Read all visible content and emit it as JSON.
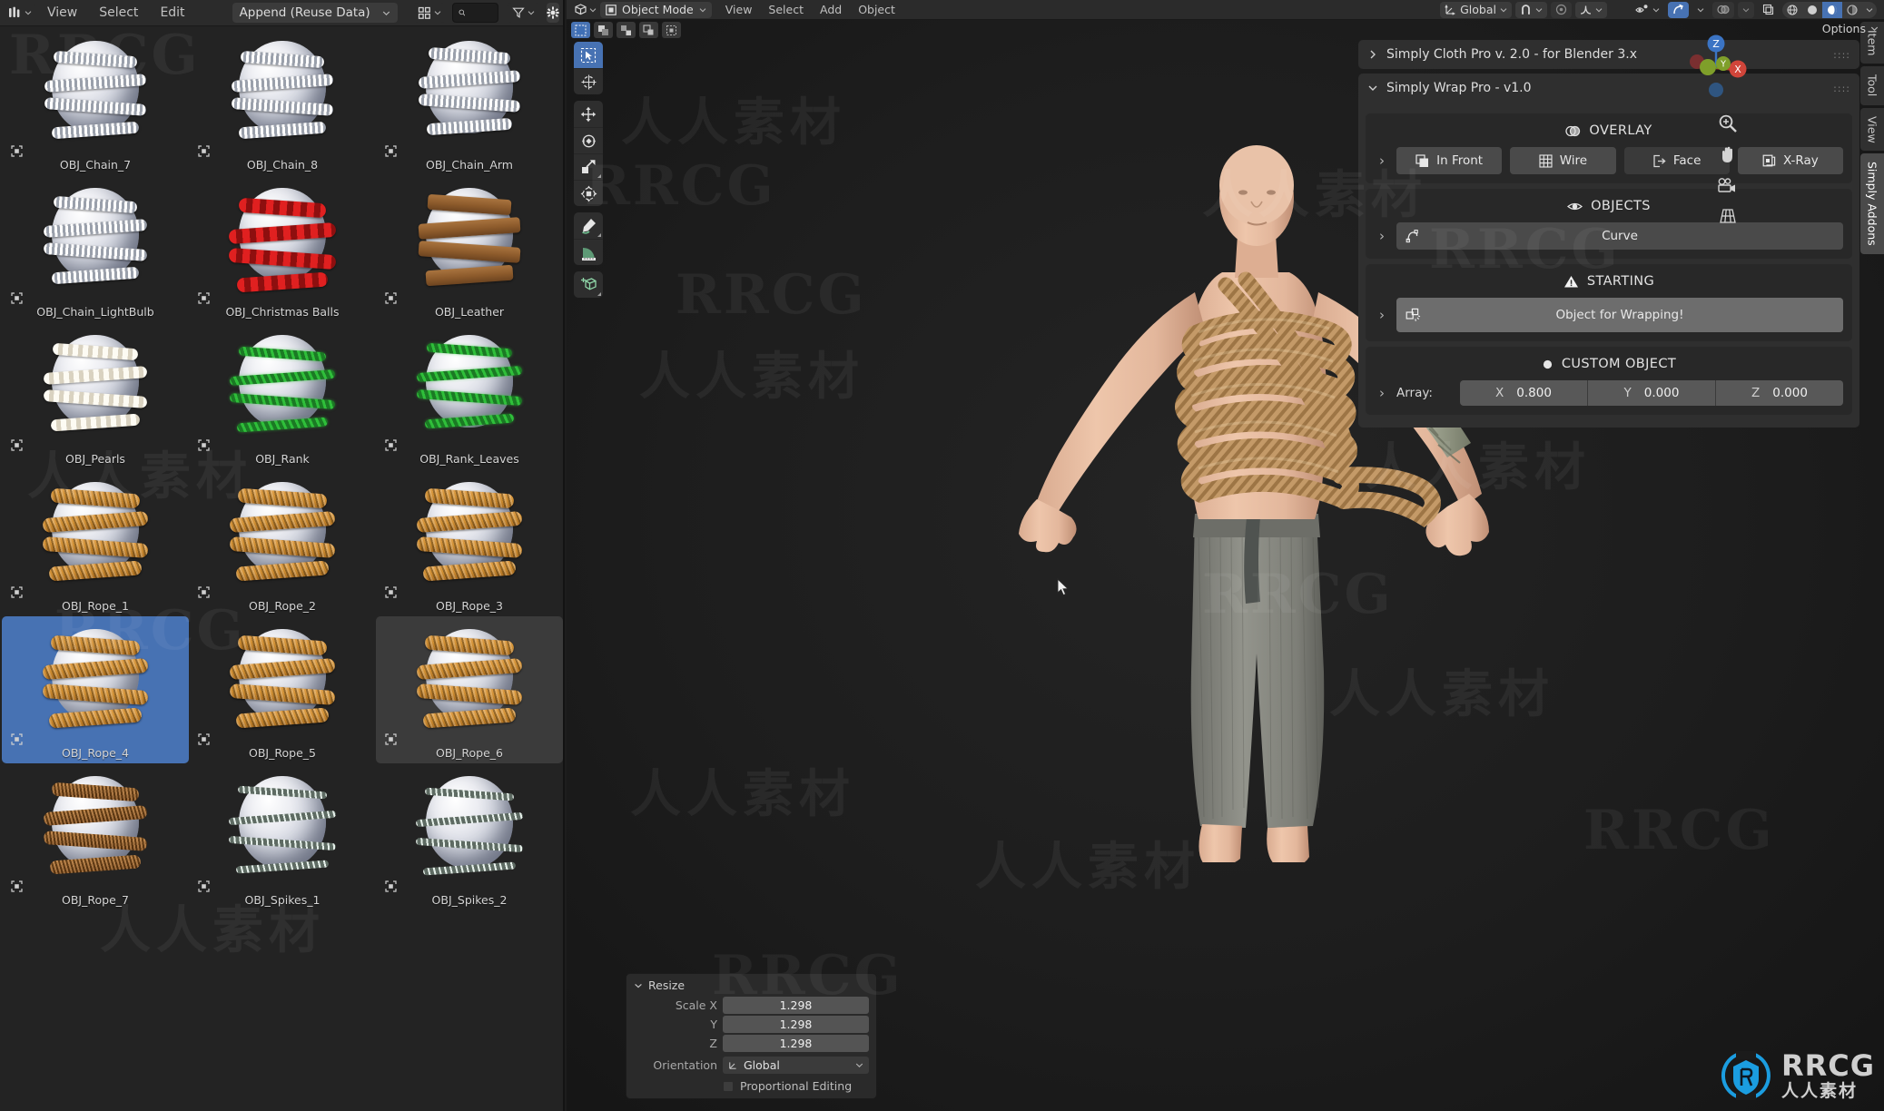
{
  "asset_browser": {
    "editor_icon": "asset-browser-icon",
    "menus": [
      "View",
      "Select",
      "Edit"
    ],
    "import_method": "Append (Reuse Data)",
    "display_mode_icon": "grid-display-icon",
    "search": {
      "placeholder": "",
      "value": ""
    },
    "filter_icon": "filter-icon",
    "settings_icon": "gear-icon",
    "assets": [
      {
        "name": "OBJ_Chain_7",
        "style": "chain",
        "selected": false,
        "active": false
      },
      {
        "name": "OBJ_Chain_8",
        "style": "chain",
        "selected": false,
        "active": false
      },
      {
        "name": "OBJ_Chain_Arm",
        "style": "chainarm",
        "selected": false,
        "active": false
      },
      {
        "name": "OBJ_Chain_LightBulb",
        "style": "bulb",
        "selected": false,
        "active": false
      },
      {
        "name": "OBJ_Christmas Balls",
        "style": "redballs",
        "selected": false,
        "active": false
      },
      {
        "name": "OBJ_Leather",
        "style": "leather",
        "selected": false,
        "active": false
      },
      {
        "name": "OBJ_Pearls",
        "style": "pearls",
        "selected": false,
        "active": false
      },
      {
        "name": "OBJ_Rank",
        "style": "vine",
        "selected": false,
        "active": false
      },
      {
        "name": "OBJ_Rank_Leaves",
        "style": "vineleaf",
        "selected": false,
        "active": false
      },
      {
        "name": "OBJ_Rope_1",
        "style": "rope",
        "selected": false,
        "active": false
      },
      {
        "name": "OBJ_Rope_2",
        "style": "rope",
        "selected": false,
        "active": false
      },
      {
        "name": "OBJ_Rope_3",
        "style": "rope",
        "selected": false,
        "active": false
      },
      {
        "name": "OBJ_Rope_4",
        "style": "rope",
        "selected": true,
        "active": false
      },
      {
        "name": "OBJ_Rope_5",
        "style": "rope",
        "selected": false,
        "active": false
      },
      {
        "name": "OBJ_Rope_6",
        "style": "rope",
        "selected": false,
        "active": true
      },
      {
        "name": "OBJ_Rope_7",
        "style": "darkrope",
        "selected": false,
        "active": false
      },
      {
        "name": "OBJ_Spikes_1",
        "style": "spikes",
        "selected": false,
        "active": false
      },
      {
        "name": "OBJ_Spikes_2",
        "style": "spikes2",
        "selected": false,
        "active": false
      }
    ]
  },
  "viewport": {
    "editor_icon": "3d-viewport-icon",
    "mode": "Object Mode",
    "menus": [
      "View",
      "Select",
      "Add",
      "Object"
    ],
    "transform_orientation": "Global",
    "snap_icon": "magnet-icon",
    "proportional_icon": "proportional-editing-icon",
    "falloff_icon": "falloff-icon",
    "select_modes": [
      "tweak-select-icon",
      "box-select-icon",
      "circle-select-icon",
      "lasso-select-icon",
      "extend-select-icon"
    ],
    "shading": {
      "visibility_icon": "show-gizmo-icon",
      "gizmo_icon": "gizmo-icon",
      "overlays_icon": "overlays-icon",
      "xray_icon": "xray-icon",
      "modes": [
        "wireframe-shading-icon",
        "solid-shading-icon",
        "material-preview-icon",
        "rendered-shading-icon"
      ],
      "active_mode_index": 2
    },
    "options_label": "Options",
    "tools": [
      "tweak-tool-icon",
      "cursor-tool-icon",
      "move-tool-icon",
      "rotate-tool-icon",
      "scale-tool-icon",
      "transform-tool-icon",
      "annotate-tool-icon",
      "measure-tool-icon",
      "add-cube-tool-icon"
    ],
    "active_tool_index": 0,
    "gizmo_axes": [
      "X",
      "Y",
      "Z"
    ],
    "nav_icons": [
      "zoom-icon",
      "pan-hand-icon",
      "camera-icon",
      "orthographic-grid-icon"
    ]
  },
  "npanel": {
    "panels": [
      {
        "title": "Simply Cloth Pro v. 2.0 - for Blender 3.x",
        "expanded": false
      },
      {
        "title": "Simply Wrap Pro - v1.0",
        "expanded": true
      }
    ],
    "sections": {
      "overlay": {
        "title": "OVERLAY",
        "icon": "overlay-icon",
        "toggles": [
          {
            "label": "In Front",
            "icon": "in-front-icon",
            "on": true
          },
          {
            "label": "Wire",
            "icon": "wire-icon",
            "on": true
          },
          {
            "label": "Face",
            "icon": "face-orientation-icon",
            "on": false
          },
          {
            "label": "X-Ray",
            "icon": "x-ray-icon",
            "on": true
          }
        ]
      },
      "objects": {
        "title": "OBJECTS",
        "icon": "eye-icon",
        "button": {
          "label": "Curve",
          "icon": "curve-icon"
        }
      },
      "starting": {
        "title": "STARTING",
        "icon": "warning-icon",
        "button": {
          "label": "Object for Wrapping!",
          "icon": "select-object-icon"
        }
      },
      "custom_object": {
        "title": "CUSTOM OBJECT",
        "icon": "radio-dot-icon",
        "array_label": "Array:",
        "axes": [
          {
            "axis": "X",
            "value": "0.800"
          },
          {
            "axis": "Y",
            "value": "0.000"
          },
          {
            "axis": "Z",
            "value": "0.000"
          }
        ]
      }
    },
    "tabs": [
      {
        "label": "Item",
        "active": false
      },
      {
        "label": "Tool",
        "active": false
      },
      {
        "label": "View",
        "active": false
      },
      {
        "label": "Simply Addons",
        "active": true
      }
    ]
  },
  "operator_panel": {
    "title": "Resize",
    "fields": [
      {
        "label": "Scale X",
        "value": "1.298"
      },
      {
        "label": "Y",
        "value": "1.298"
      },
      {
        "label": "Z",
        "value": "1.298"
      }
    ],
    "orientation_label": "Orientation",
    "orientation_value": "Global",
    "proportional_label": "Proportional Editing",
    "proportional_checked": false
  },
  "watermarks": {
    "cn_text": "人人素材",
    "rr_text": "RRCG",
    "logo_title": "RRCG",
    "logo_subtitle": "人人素材",
    "logo_color": "#1b9de0"
  },
  "colors": {
    "accent_blue": "#4772b3",
    "panel_bg": "#2f2f2f",
    "editor_bg": "#1b1b1b",
    "header_bg": "#2b2b2b",
    "rope_orange": "#d08f33"
  }
}
